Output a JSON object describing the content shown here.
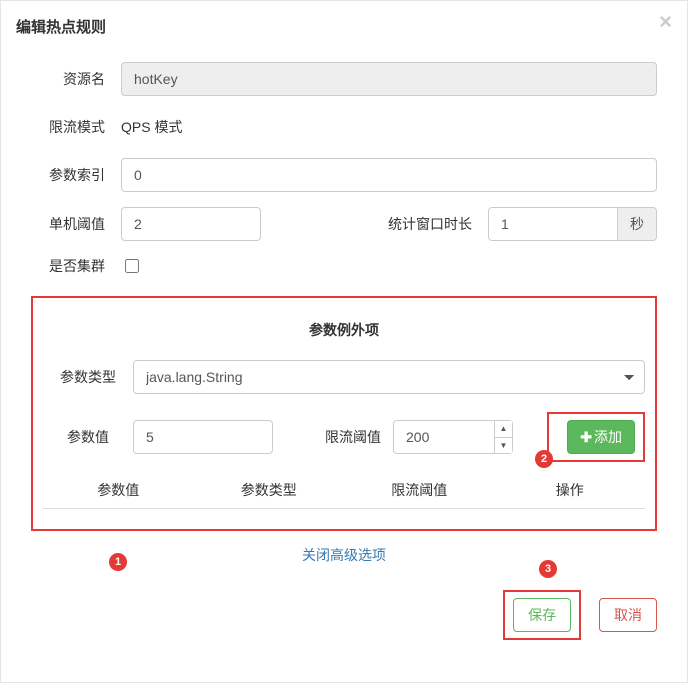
{
  "modal": {
    "title": "编辑热点规则",
    "close_icon": "×"
  },
  "form": {
    "resource_label": "资源名",
    "resource_value": "hotKey",
    "mode_label": "限流模式",
    "mode_value": "QPS 模式",
    "param_index_label": "参数索引",
    "param_index_value": "0",
    "threshold_label": "单机阈值",
    "threshold_value": "2",
    "window_label": "统计窗口时长",
    "window_value": "1",
    "window_unit": "秒",
    "cluster_label": "是否集群"
  },
  "advanced": {
    "section_title": "参数例外项",
    "param_type_label": "参数类型",
    "param_type_value": "java.lang.String",
    "param_value_label": "参数值",
    "param_value_value": "5",
    "limit_label": "限流阈值",
    "limit_value": "200",
    "add_button": "添加",
    "table_headers": {
      "value": "参数值",
      "type": "参数类型",
      "limit": "限流阈值",
      "action": "操作"
    },
    "close_link": "关闭高级选项"
  },
  "footer": {
    "save": "保存",
    "cancel": "取消"
  },
  "annotations": {
    "a1": "1",
    "a2": "2",
    "a3": "3"
  }
}
